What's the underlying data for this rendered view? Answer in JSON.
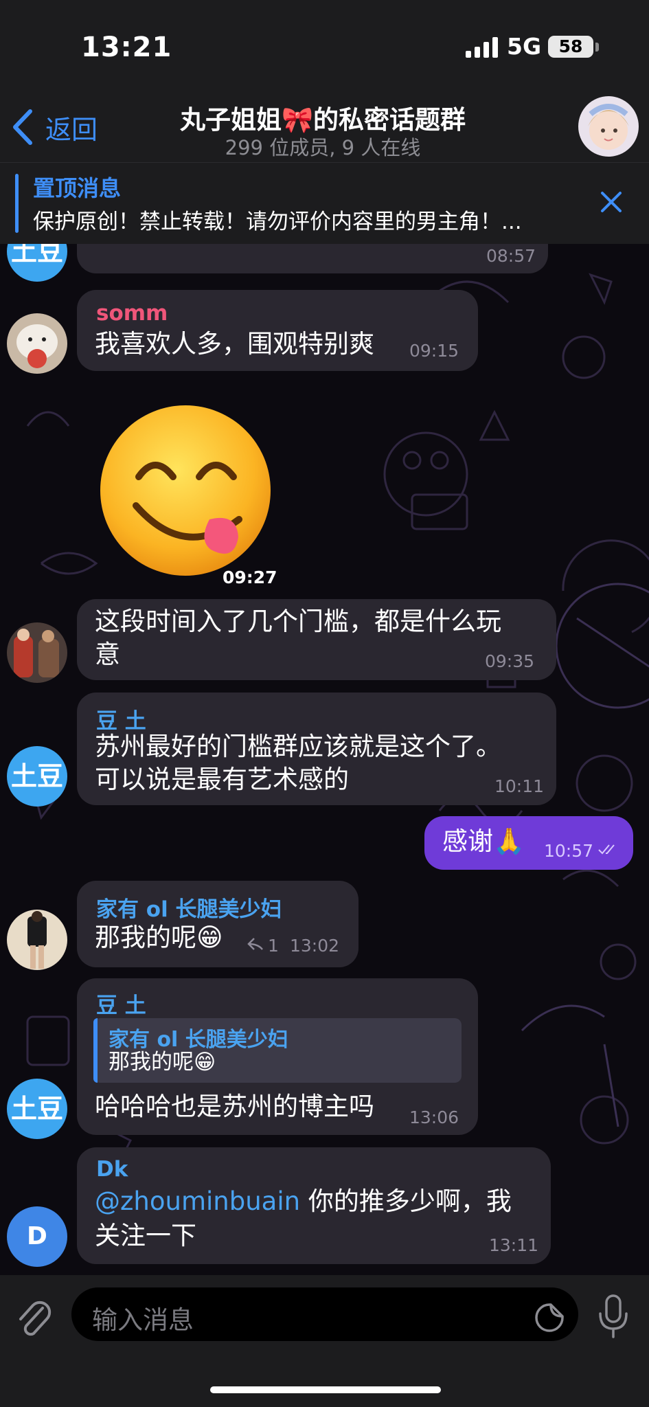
{
  "status": {
    "time": "13:21",
    "network": "5G",
    "battery": "58"
  },
  "header": {
    "back_label": "返回",
    "title": "丸子姐姐🎀的私密话题群",
    "subtitle": "299 位成员, 9 人在线"
  },
  "pinned": {
    "title": "置顶消息",
    "text": "保护原创！禁止转载！请勿评价内容里的男主角！..."
  },
  "messages": {
    "m0": {
      "avatar_text": "土豆",
      "time": "08:57"
    },
    "m1": {
      "sender": "somm",
      "text": "我喜欢人多，围观特别爽",
      "time": "09:15"
    },
    "m2": {
      "sticker": "😋",
      "time": "09:27"
    },
    "m3": {
      "line1": "这段时间入了几个门槛，都是什么玩",
      "line2": "意",
      "time": "09:35"
    },
    "m4": {
      "sender": "豆 土",
      "line1": "苏州最好的门槛群应该就是这个了。",
      "line2": "可以说是最有艺术感的",
      "time": "10:11",
      "avatar_text": "土豆"
    },
    "m5": {
      "text": "感谢🙏",
      "time": "10:57"
    },
    "m6": {
      "sender": "家有 ol 长腿美少妇",
      "text": "那我的呢😁",
      "replies": "1",
      "time": "13:02"
    },
    "m7": {
      "sender": "豆 土",
      "reply_sender": "家有 ol 长腿美少妇",
      "reply_text": "那我的呢😁",
      "text": "哈哈哈也是苏州的博主吗",
      "time": "13:06",
      "avatar_text": "土豆"
    },
    "m8": {
      "sender": "Dk",
      "mention": "@zhouminbuain",
      "line1_rest": " 你的推多少啊，我",
      "line2": "关注一下",
      "time": "13:11",
      "avatar_text": "D"
    }
  },
  "input": {
    "placeholder": "输入消息"
  },
  "colors": {
    "accent": "#3e8ef7",
    "outgoing": "#6f3bd8",
    "incoming": "#2a2730",
    "sender_somm": "#f0567a",
    "sender_blue": "#4aa3f0"
  }
}
